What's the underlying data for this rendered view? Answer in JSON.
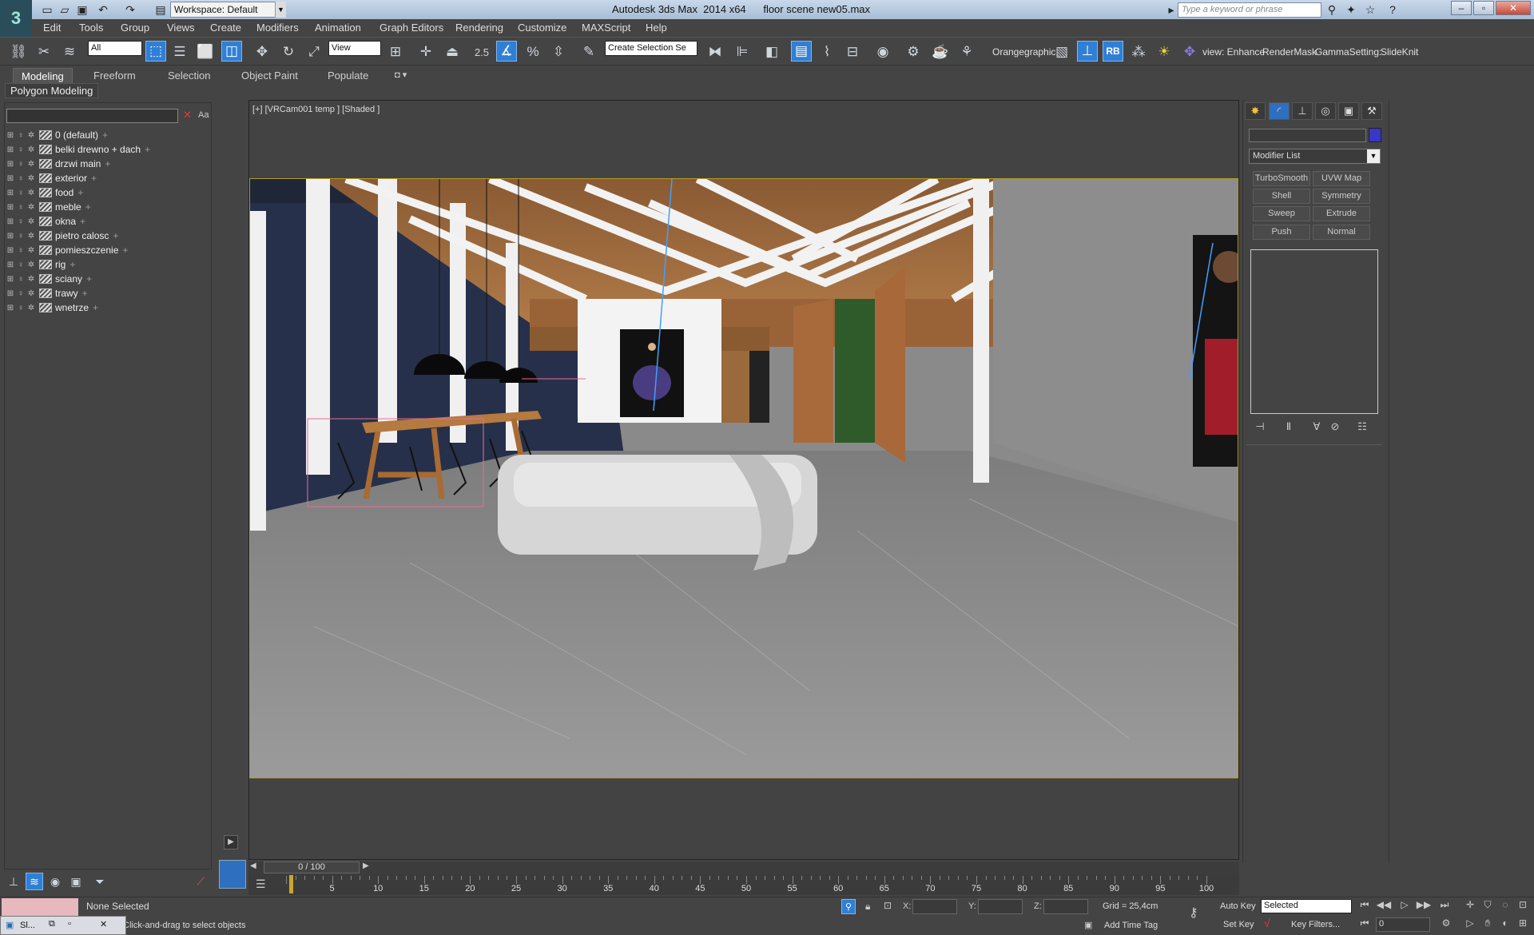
{
  "app": {
    "title": "Autodesk 3ds Max  2014 x64      floor scene new05.max",
    "workspace": "Workspace: Default",
    "search_placeholder": "Type a keyword or phrase"
  },
  "menu": [
    "Edit",
    "Tools",
    "Group",
    "Views",
    "Create",
    "Modifiers",
    "Animation",
    "Graph Editors",
    "Rendering",
    "Customize",
    "MAXScript",
    "Help"
  ],
  "toolbar": {
    "selection_filter": "All",
    "ref_coord": "View",
    "snap_value": "2.5",
    "named_selection": "Create Selection Se",
    "plugin_labels": [
      "Orangegraphic",
      "RB",
      "view: Enhance",
      "RenderMask",
      "GammaSetting:",
      "SlideKnit"
    ]
  },
  "ribbon": {
    "tabs": [
      "Modeling",
      "Freeform",
      "Selection",
      "Object Paint",
      "Populate"
    ],
    "sub_label": "Polygon Modeling"
  },
  "explorer": {
    "search_close": "✕",
    "search_case": "Aa",
    "layers": [
      "0 (default)",
      "belki drewno + dach",
      "drzwi main",
      "exterior",
      "food",
      "meble",
      "okna",
      "pietro calosc",
      "pomieszczenie",
      "rig",
      "sciany",
      "trawy",
      "wnetrze"
    ]
  },
  "viewport": {
    "label": "[+] [VRCam001 temp ] [Shaded ]"
  },
  "command_panel": {
    "modifier_list": "Modifier List",
    "modifier_buttons": [
      "TurboSmooth",
      "UVW Map",
      "Shell",
      "Symmetry",
      "Sweep",
      "Extrude",
      "Push",
      "Normal"
    ],
    "object_color": "#3737c8"
  },
  "timeline": {
    "frame_indicator": "0 / 100",
    "ticks": [
      "5",
      "10",
      "15",
      "20",
      "25",
      "30",
      "35",
      "40",
      "45",
      "50",
      "55",
      "60",
      "65",
      "70",
      "75",
      "80",
      "85",
      "90",
      "95",
      "100"
    ]
  },
  "status": {
    "selection": "None Selected",
    "prompt": "Click-and-drag to select objects",
    "x_label": "X:",
    "y_label": "Y:",
    "z_label": "Z:",
    "grid": "Grid = 25,4cm",
    "add_time_tag": "Add Time Tag",
    "auto_key": "Auto Key",
    "set_key": "Set Key",
    "key_mode": "Selected",
    "key_filters": "Key Filters...",
    "current_frame": "0",
    "taskbar_label": "Sl..."
  }
}
